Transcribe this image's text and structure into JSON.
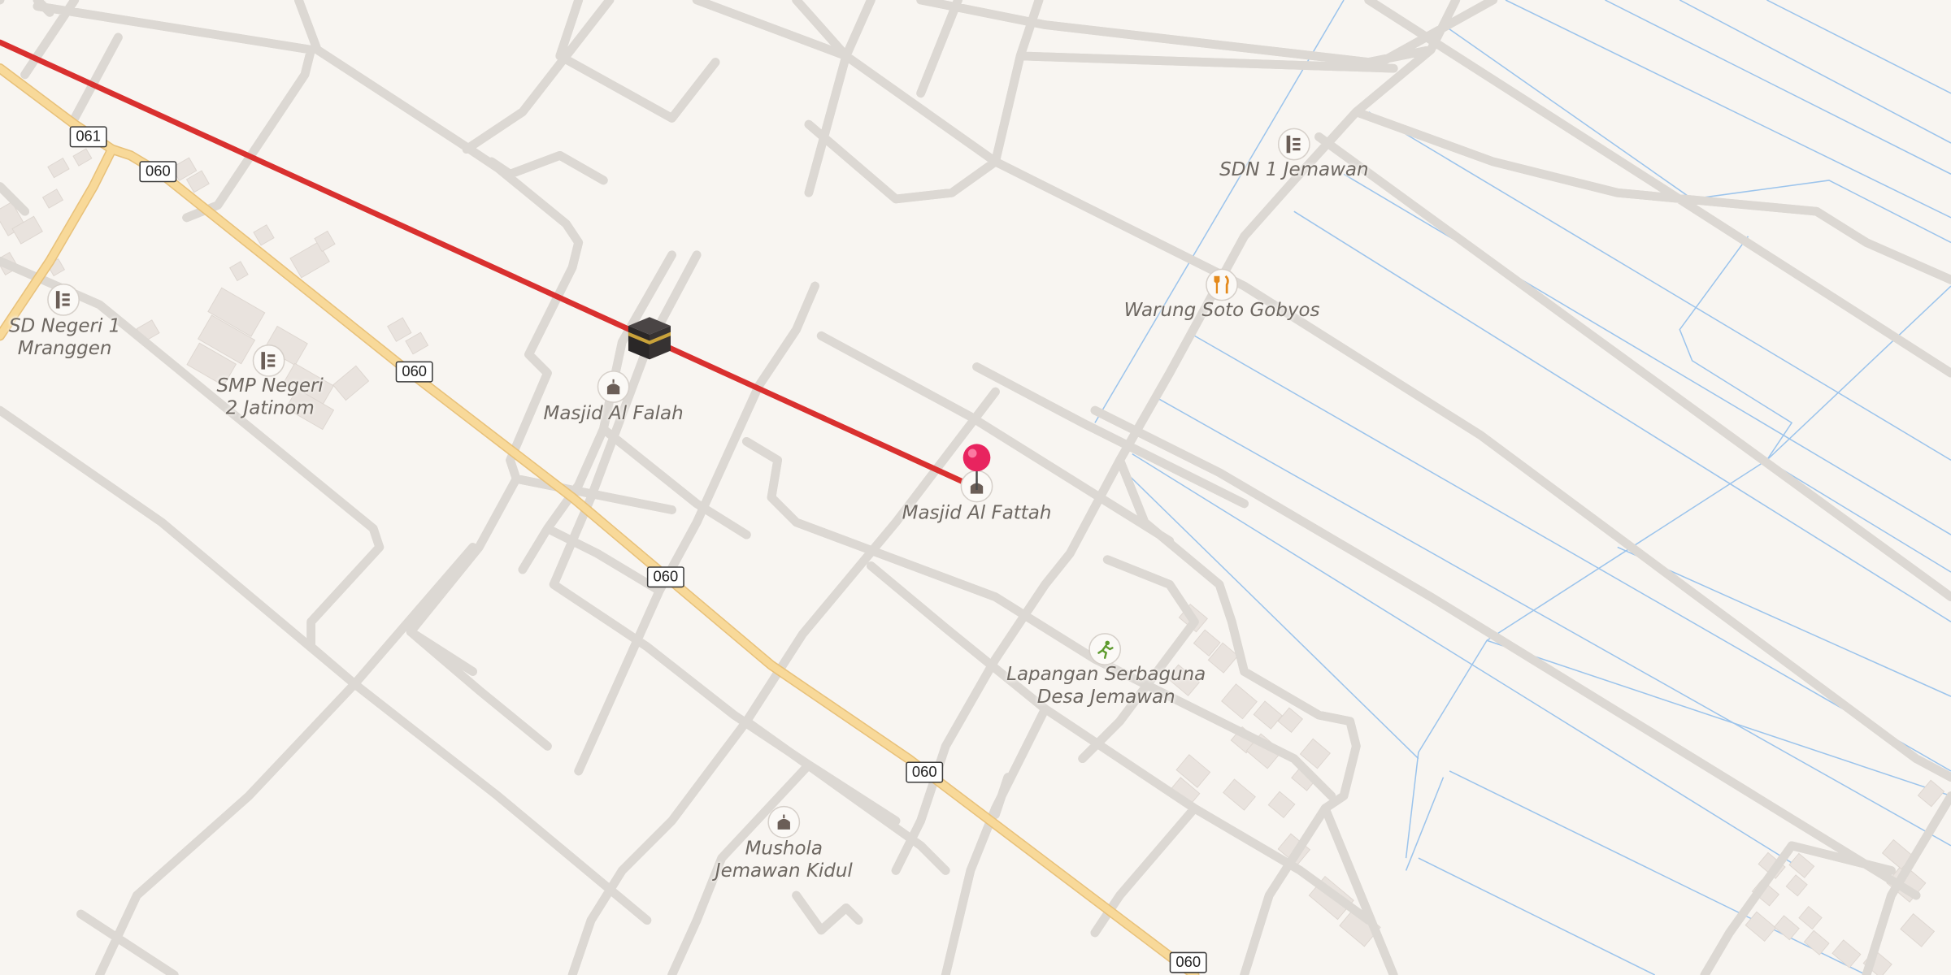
{
  "route_shields": [
    {
      "id": "s061",
      "label": "061"
    },
    {
      "id": "s060a",
      "label": "060"
    },
    {
      "id": "s060b",
      "label": "060"
    },
    {
      "id": "s060c",
      "label": "060"
    },
    {
      "id": "s060d",
      "label": "060"
    },
    {
      "id": "s060e",
      "label": "060"
    }
  ],
  "pois": {
    "sd_negeri_1": {
      "label_line1": "SD Negeri 1",
      "label_line2": "Mranggen",
      "icon": "school-icon"
    },
    "smp_negeri_2": {
      "label_line1": "SMP Negeri",
      "label_line2": "2 Jatinom",
      "icon": "school-icon"
    },
    "masjid_al_falah": {
      "label_line1": "Masjid Al Falah",
      "icon": "mosque-icon"
    },
    "masjid_al_fattah": {
      "label_line1": "Masjid Al Fattah",
      "icon": "mosque-icon"
    },
    "sdn_1_jemawan": {
      "label_line1": "SDN 1 Jemawan",
      "icon": "school-icon"
    },
    "warung_soto": {
      "label_line1": "Warung Soto Gobyos",
      "icon": "restaurant-icon"
    },
    "lapangan": {
      "label_line1": "Lapangan Serbaguna",
      "label_line2": "Desa Jemawan",
      "icon": "sports-field-icon"
    },
    "mushola": {
      "label_line1": "Mushola",
      "label_line2": "Jemawan Kidul",
      "icon": "mosque-icon"
    }
  },
  "colors": {
    "background": "#f8f5f1",
    "road": "#ffffff",
    "main_road": "#f8d999",
    "qibla_line": "#d9302f",
    "pin": "#e8245f",
    "water_lines": "#9cc4ec"
  },
  "markers": {
    "location_pin": "location-pin-icon",
    "kaaba": "kaaba-icon",
    "qibla_line": "qibla-direction-line"
  }
}
